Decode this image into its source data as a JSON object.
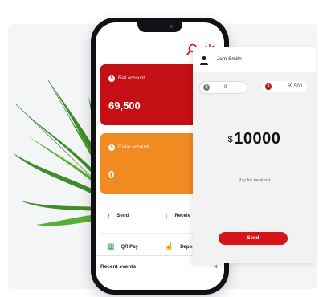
{
  "colors": {
    "accent_red": "#c40f14",
    "accent_orange": "#f28a22",
    "qr_green": "#2a9d4a",
    "deposit_blue": "#1e6fd9"
  },
  "icons": [
    "search-icon",
    "settings-icon",
    "user-icon",
    "send-arrow-icon",
    "receive-arrow-icon",
    "qr-icon",
    "deposit-icon",
    "close-icon"
  ],
  "cards": [
    {
      "badge": "$",
      "label": "Rial account",
      "amount": "69,500"
    },
    {
      "badge": "$",
      "label": "Dollar account",
      "amount": "0"
    }
  ],
  "actions": {
    "send": "Send",
    "receive": "Receiv",
    "qr_pay": "QR Pay",
    "deposit": "Depos"
  },
  "recent": {
    "title": "Recent events",
    "close": "×"
  },
  "transfer": {
    "recipient": "Jom Smith",
    "dollar_badge": "$",
    "dollar_value": "0",
    "rial_badge": "$",
    "rial_value": "69,500",
    "currency_symbol": "$",
    "amount": "10000",
    "note": "Pay for beakfast",
    "send_button": "Send"
  }
}
